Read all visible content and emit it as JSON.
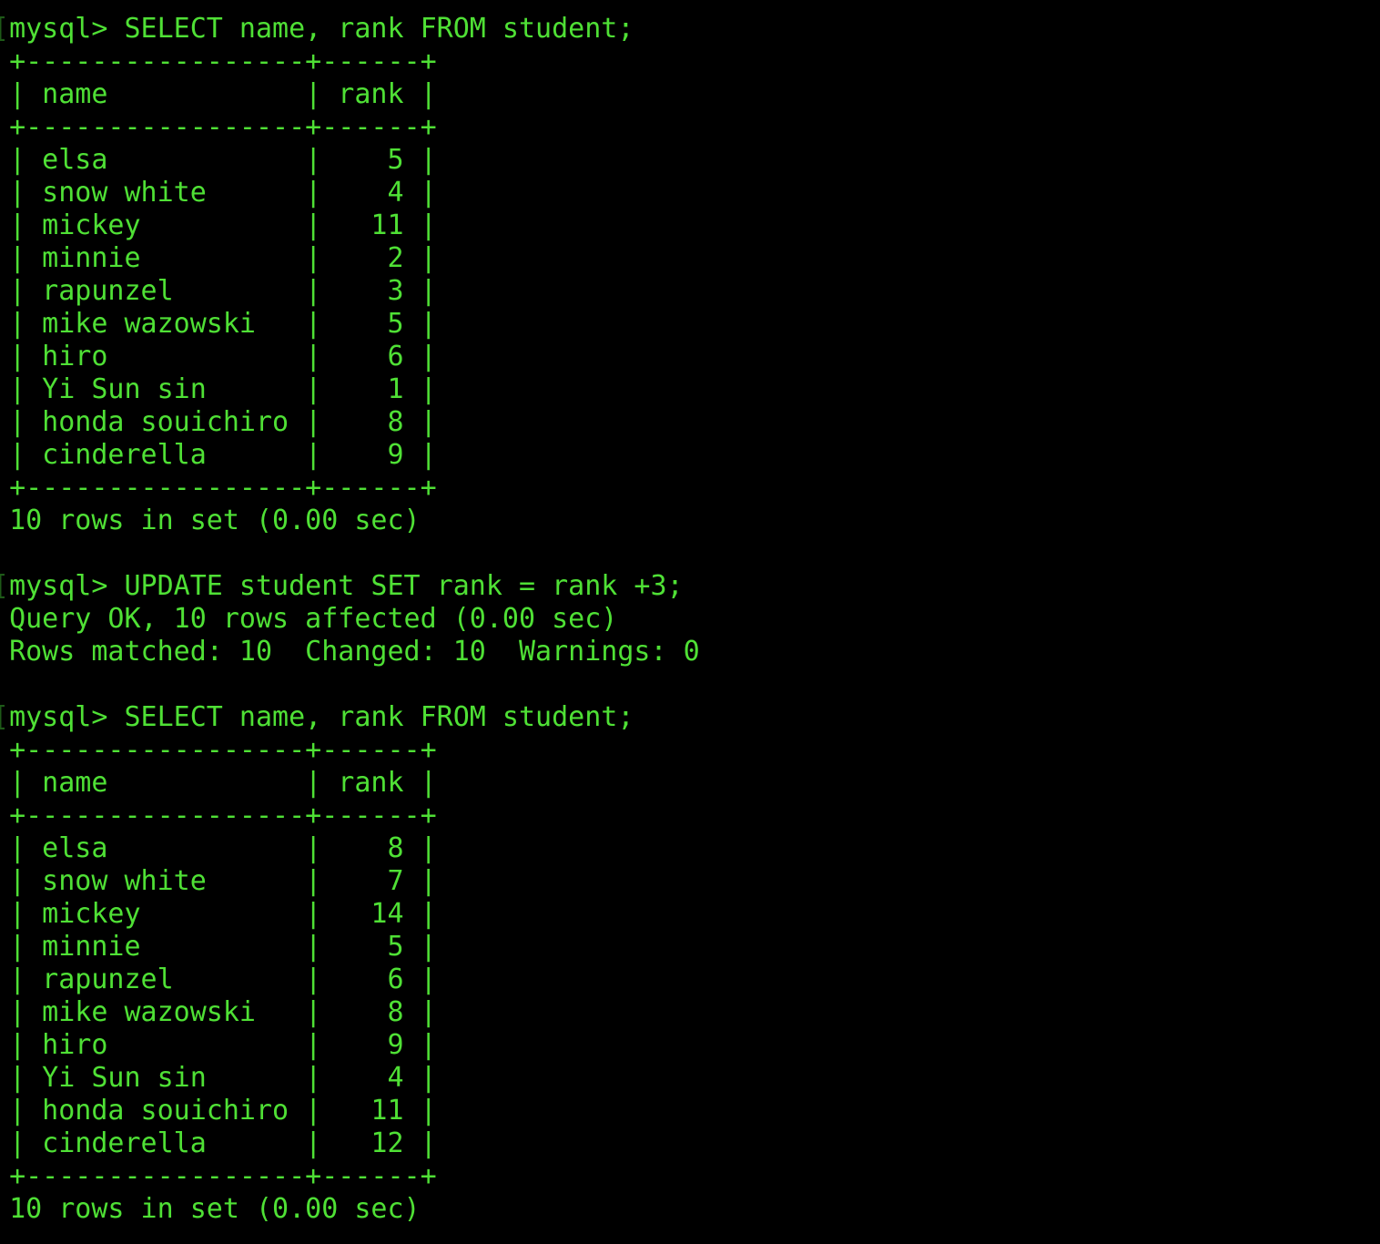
{
  "terminal": {
    "title": "mysql client session",
    "background_color": "#000000",
    "foreground_color": "#4FE035",
    "dim_color": "#1e5a18",
    "prompt": "mysql>",
    "edge_glyph": "[",
    "font_size_px": 30,
    "line_height_px": 36
  },
  "session": {
    "blocks": [
      {
        "type": "command",
        "prompt": "mysql>",
        "command": " SELECT name, rank FROM student;"
      },
      {
        "type": "table",
        "separator": "+-----------------+------+",
        "header": "| name            | rank |",
        "rows": [
          "| elsa            |    5 |",
          "| snow white      |    4 |",
          "| mickey          |   11 |",
          "| minnie          |    2 |",
          "| rapunzel        |    3 |",
          "| mike wazowski   |    5 |",
          "| hiro            |    6 |",
          "| Yi Sun sin      |    1 |",
          "| honda souichiro |    8 |",
          "| cinderella      |    9 |"
        ],
        "footer": "10 rows in set (0.00 sec)"
      },
      {
        "type": "blank"
      },
      {
        "type": "command",
        "prompt": "mysql>",
        "command": " UPDATE student SET rank = rank +3;"
      },
      {
        "type": "status",
        "lines": [
          "Query OK, 10 rows affected (0.00 sec)",
          "Rows matched: 10  Changed: 10  Warnings: 0"
        ]
      },
      {
        "type": "blank"
      },
      {
        "type": "command",
        "prompt": "mysql>",
        "command": " SELECT name, rank FROM student;"
      },
      {
        "type": "table",
        "separator": "+-----------------+------+",
        "header": "| name            | rank |",
        "rows": [
          "| elsa            |    8 |",
          "| snow white      |    7 |",
          "| mickey          |   14 |",
          "| minnie          |    5 |",
          "| rapunzel        |    6 |",
          "| mike wazowski   |    8 |",
          "| hiro            |    9 |",
          "| Yi Sun sin      |    4 |",
          "| honda souichiro |   11 |",
          "| cinderella      |   12 |"
        ],
        "footer": "10 rows in set (0.00 sec)"
      }
    ]
  },
  "query_results": {
    "columns": [
      "name",
      "rank"
    ],
    "before_update": [
      {
        "name": "elsa",
        "rank": 5
      },
      {
        "name": "snow white",
        "rank": 4
      },
      {
        "name": "mickey",
        "rank": 11
      },
      {
        "name": "minnie",
        "rank": 2
      },
      {
        "name": "rapunzel",
        "rank": 3
      },
      {
        "name": "mike wazowski",
        "rank": 5
      },
      {
        "name": "hiro",
        "rank": 6
      },
      {
        "name": "Yi Sun sin",
        "rank": 1
      },
      {
        "name": "honda souichiro",
        "rank": 8
      },
      {
        "name": "cinderella",
        "rank": 9
      }
    ],
    "after_update": [
      {
        "name": "elsa",
        "rank": 8
      },
      {
        "name": "snow white",
        "rank": 7
      },
      {
        "name": "mickey",
        "rank": 14
      },
      {
        "name": "minnie",
        "rank": 5
      },
      {
        "name": "rapunzel",
        "rank": 6
      },
      {
        "name": "mike wazowski",
        "rank": 8
      },
      {
        "name": "hiro",
        "rank": 9
      },
      {
        "name": "Yi Sun sin",
        "rank": 4
      },
      {
        "name": "honda souichiro",
        "rank": 11
      },
      {
        "name": "cinderella",
        "rank": 12
      }
    ],
    "row_count_text": "10 rows in set (0.00 sec)",
    "update_applied": "rank = rank +3"
  },
  "lines": [
    {
      "edge": "[",
      "text": "mysql> SELECT name, rank FROM student;"
    },
    {
      "edge": " ",
      "text": "+-----------------+------+"
    },
    {
      "edge": " ",
      "text": "| name            | rank |"
    },
    {
      "edge": " ",
      "text": "+-----------------+------+"
    },
    {
      "edge": " ",
      "text": "| elsa            |    5 |"
    },
    {
      "edge": " ",
      "text": "| snow white      |    4 |"
    },
    {
      "edge": " ",
      "text": "| mickey          |   11 |"
    },
    {
      "edge": " ",
      "text": "| minnie          |    2 |"
    },
    {
      "edge": " ",
      "text": "| rapunzel        |    3 |"
    },
    {
      "edge": " ",
      "text": "| mike wazowski   |    5 |"
    },
    {
      "edge": " ",
      "text": "| hiro            |    6 |"
    },
    {
      "edge": " ",
      "text": "| Yi Sun sin      |    1 |"
    },
    {
      "edge": " ",
      "text": "| honda souichiro |    8 |"
    },
    {
      "edge": " ",
      "text": "| cinderella      |    9 |"
    },
    {
      "edge": " ",
      "text": "+-----------------+------+"
    },
    {
      "edge": " ",
      "text": "10 rows in set (0.00 sec)"
    },
    {
      "edge": " ",
      "text": ""
    },
    {
      "edge": "[",
      "text": "mysql> UPDATE student SET rank = rank +3;"
    },
    {
      "edge": " ",
      "text": "Query OK, 10 rows affected (0.00 sec)"
    },
    {
      "edge": " ",
      "text": "Rows matched: 10  Changed: 10  Warnings: 0"
    },
    {
      "edge": " ",
      "text": ""
    },
    {
      "edge": "[",
      "text": "mysql> SELECT name, rank FROM student;"
    },
    {
      "edge": " ",
      "text": "+-----------------+------+"
    },
    {
      "edge": " ",
      "text": "| name            | rank |"
    },
    {
      "edge": " ",
      "text": "+-----------------+------+"
    },
    {
      "edge": " ",
      "text": "| elsa            |    8 |"
    },
    {
      "edge": " ",
      "text": "| snow white      |    7 |"
    },
    {
      "edge": " ",
      "text": "| mickey          |   14 |"
    },
    {
      "edge": " ",
      "text": "| minnie          |    5 |"
    },
    {
      "edge": " ",
      "text": "| rapunzel        |    6 |"
    },
    {
      "edge": " ",
      "text": "| mike wazowski   |    8 |"
    },
    {
      "edge": " ",
      "text": "| hiro            |    9 |"
    },
    {
      "edge": " ",
      "text": "| Yi Sun sin      |    4 |"
    },
    {
      "edge": " ",
      "text": "| honda souichiro |   11 |"
    },
    {
      "edge": " ",
      "text": "| cinderella      |   12 |"
    },
    {
      "edge": " ",
      "text": "+-----------------+------+"
    },
    {
      "edge": " ",
      "text": "10 rows in set (0.00 sec)"
    }
  ]
}
